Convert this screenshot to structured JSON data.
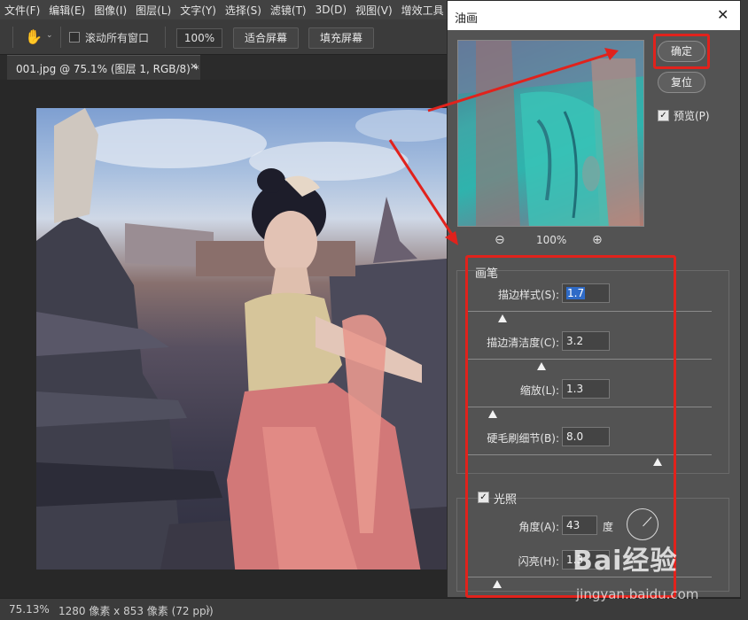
{
  "menu": [
    "文件(F)",
    "编辑(E)",
    "图像(I)",
    "图层(L)",
    "文字(Y)",
    "选择(S)",
    "滤镜(T)",
    "3D(D)",
    "视图(V)",
    "增效工具"
  ],
  "options": {
    "scroll_all": "滚动所有窗口",
    "zoom": "100%",
    "fit_screen": "适合屏幕",
    "fill_screen": "填充屏幕"
  },
  "doc_tab": {
    "title": "001.jpg @ 75.1% (图层 1, RGB/8) *",
    "close": "×"
  },
  "status": {
    "zoom": "75.13%",
    "dimensions": "1280 像素 x 853 像素 (72 ppi)",
    "arrow": "〉"
  },
  "dialog": {
    "title": "油画",
    "close": "✕",
    "ok": "确定",
    "reset": "复位",
    "preview_label": "预览(P)",
    "preview_checked": true,
    "preview_zoom": "100%",
    "brush": {
      "title": "画笔",
      "params": [
        {
          "label": "描边样式(S):",
          "value": "1.7",
          "slider": 0.15,
          "selected": true
        },
        {
          "label": "描边清洁度(C):",
          "value": "3.2",
          "slider": 0.31
        },
        {
          "label": "缩放(L):",
          "value": "1.3",
          "slider": 0.11
        },
        {
          "label": "硬毛刷细节(B):",
          "value": "8.0",
          "slider": 0.78
        }
      ]
    },
    "lighting": {
      "title": "光照",
      "checked": true,
      "angle_label": "角度(A):",
      "angle_value": "43",
      "angle_unit": "度",
      "shine_label": "闪亮(H):",
      "shine_value": "1.3",
      "shine_slider": 0.13
    }
  },
  "watermark": {
    "brand": "Bai经验",
    "url": "jingyan.baidu.com"
  },
  "colors": {
    "highlight": "#e1221c",
    "selection": "#2f6bc7"
  }
}
